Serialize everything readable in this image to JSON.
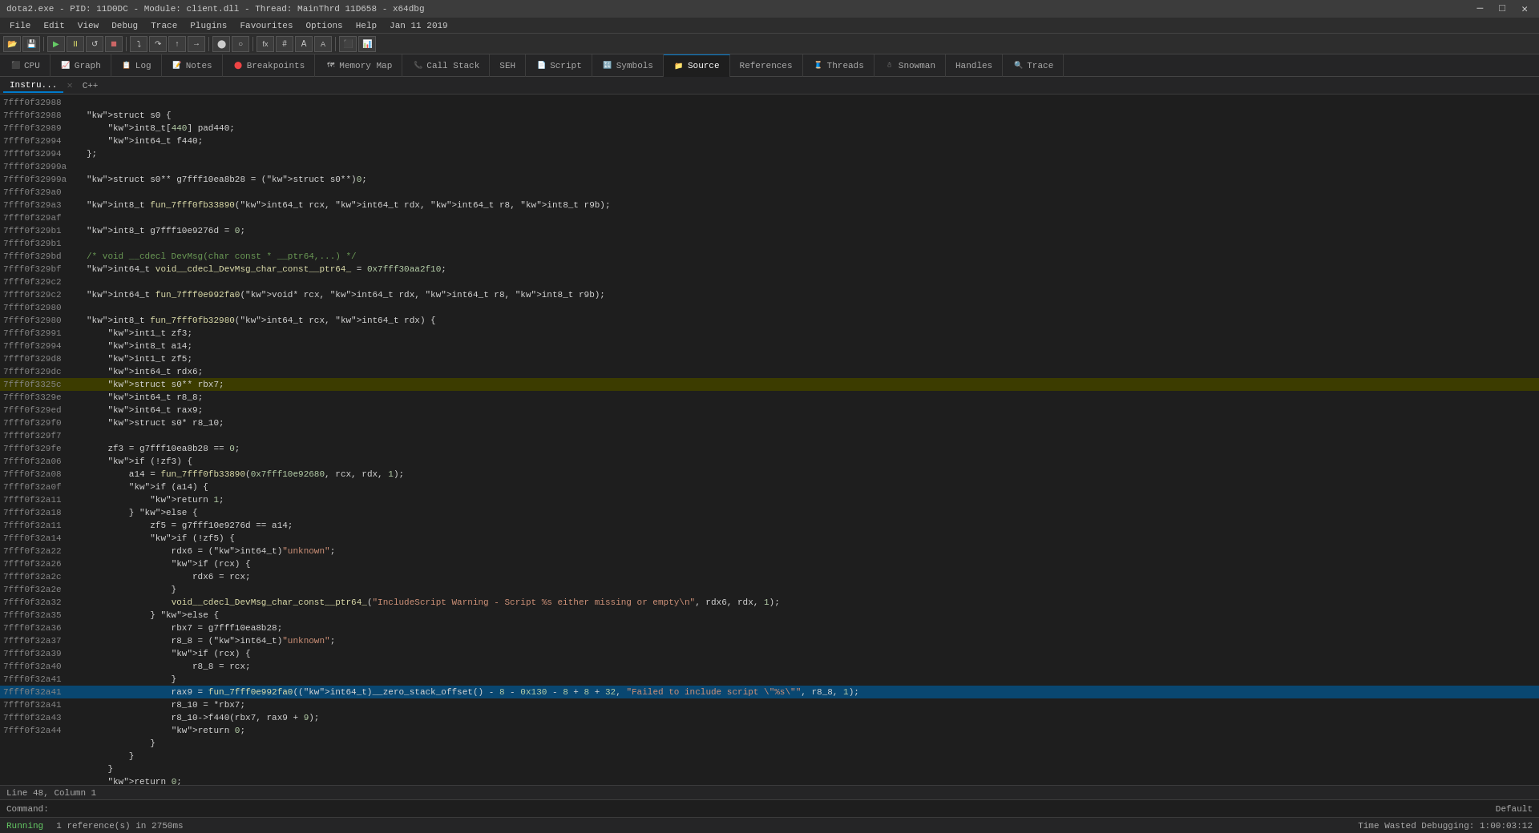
{
  "titlebar": {
    "title": "dota2.exe - PID: 11D0DC - Module: client.dll - Thread: MainThrd 11D658 - x64dbg",
    "minimize": "─",
    "maximize": "□",
    "close": "✕"
  },
  "menubar": {
    "items": [
      "File",
      "Edit",
      "View",
      "Debug",
      "Trace",
      "Plugins",
      "Favourites",
      "Options",
      "Help",
      "Jan 11 2019"
    ]
  },
  "tabs": [
    {
      "id": "cpu",
      "label": "CPU",
      "icon": "⬛",
      "active": false
    },
    {
      "id": "graph",
      "label": "Graph",
      "active": false
    },
    {
      "id": "log",
      "label": "Log",
      "active": false
    },
    {
      "id": "notes",
      "label": "Notes",
      "active": false
    },
    {
      "id": "breakpoints",
      "label": "Breakpoints",
      "active": false
    },
    {
      "id": "memory-map",
      "label": "Memory Map",
      "active": false
    },
    {
      "id": "call-stack",
      "label": "Call Stack",
      "active": false
    },
    {
      "id": "seh",
      "label": "SEH",
      "active": false
    },
    {
      "id": "script",
      "label": "Script",
      "active": false
    },
    {
      "id": "symbols",
      "label": "Symbols",
      "active": false
    },
    {
      "id": "source",
      "label": "Source",
      "active": true
    },
    {
      "id": "references",
      "label": "References",
      "active": false
    },
    {
      "id": "threads",
      "label": "Threads",
      "active": false
    },
    {
      "id": "snowman",
      "label": "Snowman",
      "active": false
    },
    {
      "id": "handles",
      "label": "Handles",
      "active": false
    },
    {
      "id": "trace",
      "label": "Trace",
      "active": false
    }
  ],
  "inner_tabs": [
    "Instru...",
    "C++"
  ],
  "code": {
    "lines": [
      {
        "addr": "7fff0f32988",
        "content": "",
        "style": ""
      },
      {
        "addr": "7fff0f32988",
        "content": "struct s0 {",
        "style": "normal",
        "highlight": false
      },
      {
        "addr": "7fff0f32989",
        "content": "    int8_t[440] pad440;",
        "style": "normal"
      },
      {
        "addr": "7fff0f32994",
        "content": "    int64_t f440;",
        "style": "normal"
      },
      {
        "addr": "7fff0f32994",
        "content": "};",
        "style": "normal"
      },
      {
        "addr": "7fff0f32999a",
        "content": "",
        "style": "normal"
      },
      {
        "addr": "7fff0f32999a",
        "content": "struct s0** g7fff10ea8b28 = (struct s0**)0;",
        "style": "normal"
      },
      {
        "addr": "7fff0f329a0",
        "content": "",
        "style": "normal"
      },
      {
        "addr": "7fff0f329a3",
        "content": "int8_t fun_7fff0fb33890(int64_t rcx, int64_t rdx, int64_t r8, int8_t r9b);",
        "style": "normal"
      },
      {
        "addr": "7fff0f329af",
        "content": "",
        "style": "normal"
      },
      {
        "addr": "7fff0f329b1",
        "content": "int8_t g7fff10e9276d = 0;",
        "style": "normal"
      },
      {
        "addr": "7fff0f329b1",
        "content": "",
        "style": "normal"
      },
      {
        "addr": "7fff0f329bd",
        "content": "/* void __cdecl DevMsg(char const * __ptr64,...) */",
        "style": "comment"
      },
      {
        "addr": "7fff0f329bf",
        "content": "int64_t void__cdecl_DevMsg_char_const__ptr64_ = 0x7fff30aa2f10;",
        "style": "normal"
      },
      {
        "addr": "7fff0f329c2",
        "content": "",
        "style": "normal"
      },
      {
        "addr": "7fff0f329c2",
        "content": "int64_t fun_7fff0e992fa0(void* rcx, int64_t rdx, int64_t r8, int8_t r9b);",
        "style": "normal"
      },
      {
        "addr": "7fff0f32980",
        "content": "",
        "style": "normal"
      },
      {
        "addr": "7fff0f32980",
        "content": "int8_t fun_7fff0fb32980(int64_t rcx, int64_t rdx) {",
        "style": "normal"
      },
      {
        "addr": "7fff0f32991",
        "content": "    int1_t zf3;",
        "style": "normal"
      },
      {
        "addr": "7fff0f32994",
        "content": "    int8_t a14;",
        "style": "normal"
      },
      {
        "addr": "7fff0f329d8",
        "content": "    int1_t zf5;",
        "style": "normal"
      },
      {
        "addr": "7fff0f329dc",
        "content": "    int64_t rdx6;",
        "style": "normal"
      },
      {
        "addr": "7fff0f3325c",
        "content": "    struct s0** rbx7;",
        "style": "normal",
        "current": true
      },
      {
        "addr": "7fff0f3329e",
        "content": "    int64_t r8_8;",
        "style": "normal"
      },
      {
        "addr": "7fff0f329ed",
        "content": "    int64_t rax9;",
        "style": "normal"
      },
      {
        "addr": "7fff0f329f0",
        "content": "    struct s0* r8_10;",
        "style": "normal"
      },
      {
        "addr": "7fff0f329f7",
        "content": "",
        "style": "normal"
      },
      {
        "addr": "7fff0f329fe",
        "content": "    zf3 = g7fff10ea8b28 == 0;",
        "style": "normal"
      },
      {
        "addr": "7fff0f32a06",
        "content": "    if (!zf3) {",
        "style": "normal"
      },
      {
        "addr": "7fff0f32a08",
        "content": "        a14 = fun_7fff0fb33890(0x7fff10e92680, rcx, rdx, 1);",
        "style": "normal"
      },
      {
        "addr": "7fff0f32a0f",
        "content": "        if (a14) {",
        "style": "normal"
      },
      {
        "addr": "7fff0f32a11",
        "content": "            return 1;",
        "style": "normal"
      },
      {
        "addr": "7fff0f32a18",
        "content": "        } else {",
        "style": "normal"
      },
      {
        "addr": "7fff0f32a11",
        "content": "            zf5 = g7fff10e9276d == a14;",
        "style": "normal"
      },
      {
        "addr": "7fff0f32a14",
        "content": "            if (!zf5) {",
        "style": "normal"
      },
      {
        "addr": "7fff0f32a22",
        "content": "                rdx6 = (int64_t)\"unknown\";",
        "style": "normal"
      },
      {
        "addr": "7fff0f32a26",
        "content": "                if (rcx) {",
        "style": "normal"
      },
      {
        "addr": "7fff0f32a2c",
        "content": "                    rdx6 = rcx;",
        "style": "normal"
      },
      {
        "addr": "7fff0f32a2e",
        "content": "                }",
        "style": "normal"
      },
      {
        "addr": "7fff0f32a32",
        "content": "                void__cdecl_DevMsg_char_const__ptr64_(\"IncludeScript Warning - Script %s either missing or empty\\n\", rdx6, rdx, 1);",
        "style": "normal"
      },
      {
        "addr": "7fff0f32a35",
        "content": "            } else {",
        "style": "normal"
      },
      {
        "addr": "7fff0f32a36",
        "content": "                rbx7 = g7fff10ea8b28;",
        "style": "normal"
      },
      {
        "addr": "7fff0f32a37",
        "content": "                r8_8 = (int64_t)\"unknown\";",
        "style": "normal"
      },
      {
        "addr": "7fff0f32a39",
        "content": "                if (rcx) {",
        "style": "normal"
      },
      {
        "addr": "7fff0f32a40",
        "content": "                    r8_8 = rcx;",
        "style": "normal"
      },
      {
        "addr": "7fff0f32a41",
        "content": "                }",
        "style": "normal"
      },
      {
        "addr": "7fff0f32a41",
        "content": "                rax9 = fun_7fff0e992fa0((int64_t)__zero_stack_offset() - 8 - 0x130 - 8 + 8 + 32, \"Failed to include script \\\"%s\\\"\", r8_8, 1);",
        "style": "normal",
        "selected": true
      },
      {
        "addr": "7fff0f32a41",
        "content": "                r8_10 = *rbx7;",
        "style": "normal"
      },
      {
        "addr": "7fff0f32a43",
        "content": "                r8_10->f440(rbx7, rax9 + 9);",
        "style": "normal"
      },
      {
        "addr": "7fff0f32a44",
        "content": "                return 0;",
        "style": "normal"
      },
      {
        "addr": "",
        "content": "            }",
        "style": "normal"
      },
      {
        "addr": "",
        "content": "        }",
        "style": "normal"
      },
      {
        "addr": "",
        "content": "    }",
        "style": "normal"
      },
      {
        "addr": "",
        "content": "    return 0;",
        "style": "normal"
      },
      {
        "addr": "",
        "content": "}",
        "style": "normal"
      }
    ]
  },
  "line_info": "Line 48, Column 1",
  "command_label": "Command:",
  "command_placeholder": "",
  "command_default": "Default",
  "status": {
    "running": "Running",
    "references": "1 reference(s) in 2750ms",
    "time_wasted": "Time Wasted Debugging: 1:00:03:12"
  }
}
